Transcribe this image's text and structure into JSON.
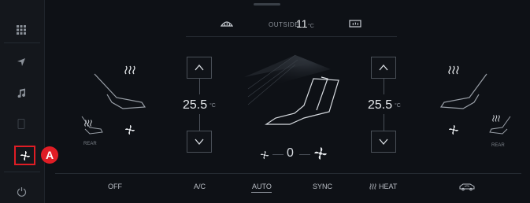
{
  "top": {
    "outside_label": "OUTSIDE",
    "outside_temp": "11",
    "outside_unit": "°C"
  },
  "left_zone": {
    "temp": "25.5",
    "unit": "°C",
    "rear_label": "REAR"
  },
  "right_zone": {
    "temp": "25.5",
    "unit": "°C",
    "rear_label": "REAR"
  },
  "fan": {
    "speed": "0"
  },
  "bottom_bar": {
    "off": "OFF",
    "ac": "A/C",
    "auto": "AUTO",
    "sync": "SYNC",
    "heat": "HEAT"
  },
  "callout": {
    "label": "A"
  },
  "colors": {
    "accent": "#e01d25",
    "background": "#0e1116"
  }
}
